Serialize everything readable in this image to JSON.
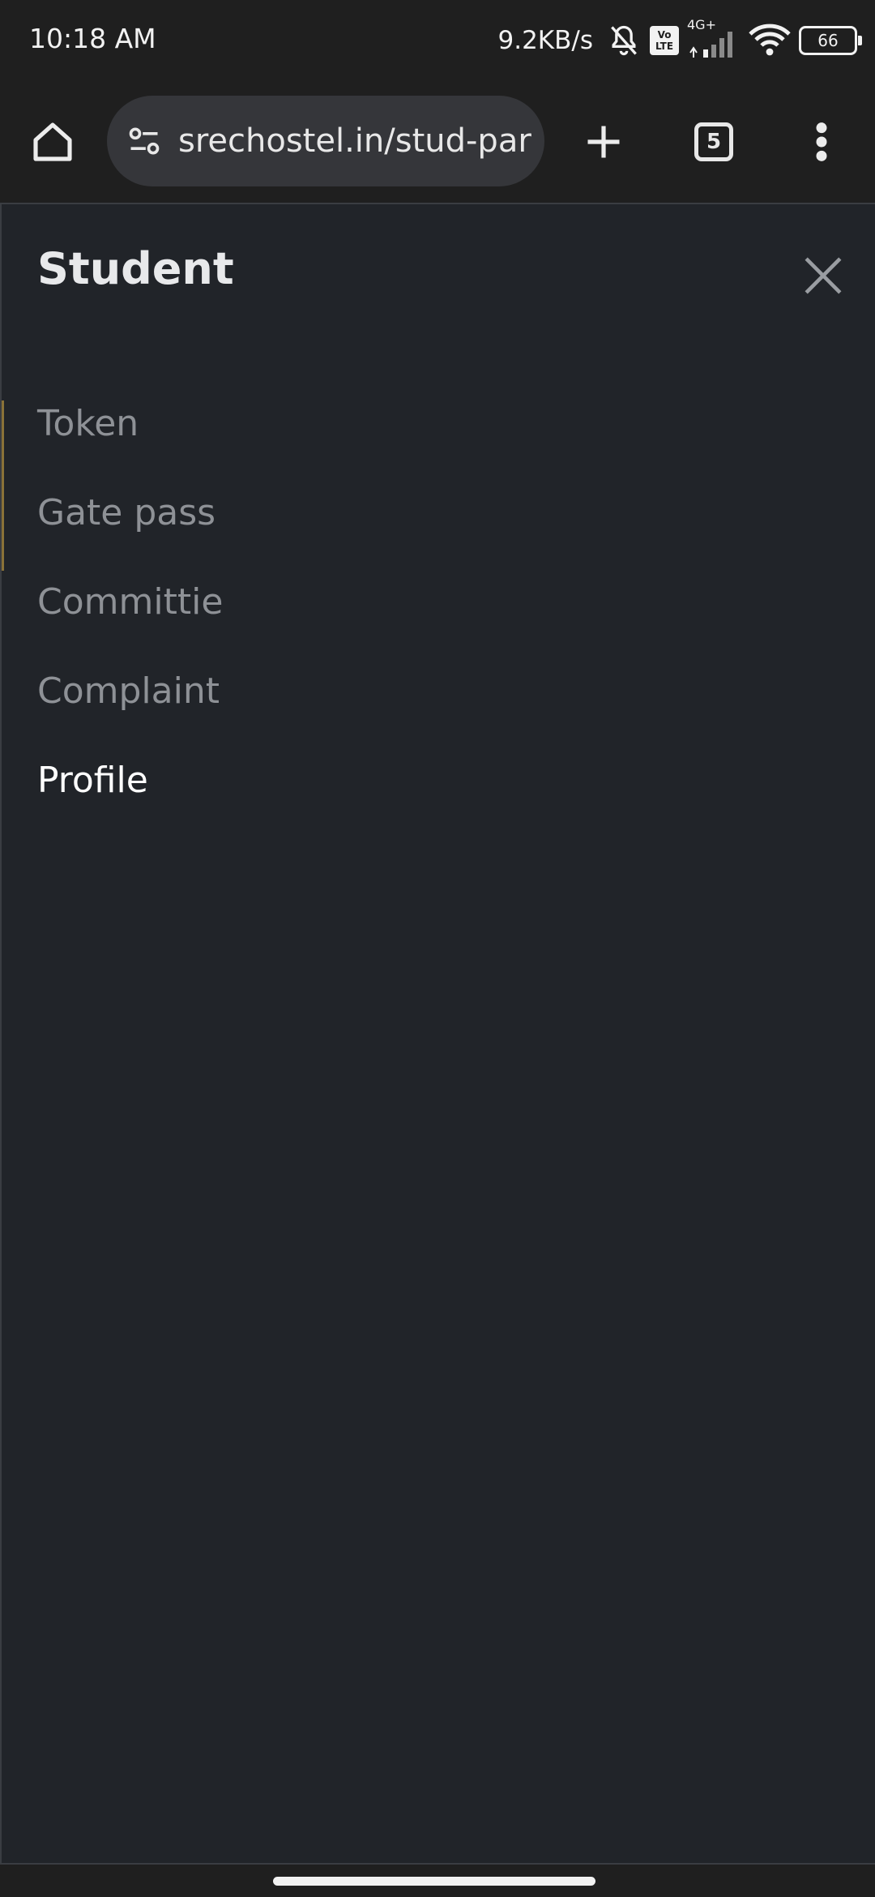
{
  "status_bar": {
    "time": "10:18 AM",
    "net_speed": "9.2KB/s",
    "volte_top": "Vo",
    "volte_bottom": "LTE",
    "network_type": "4G+",
    "battery": "66"
  },
  "browser": {
    "url": "srechostel.in/stud-par",
    "tab_count": "5"
  },
  "drawer": {
    "title": "Student",
    "items": [
      {
        "label": "Token"
      },
      {
        "label": "Gate pass"
      },
      {
        "label": "Committie"
      },
      {
        "label": "Complaint"
      },
      {
        "label": "Profile"
      }
    ]
  },
  "colors": {
    "accent_edge": "#8a7238",
    "page_bg": "#212429",
    "inactive_item": "#8e9196",
    "active_item": "#ffffff"
  }
}
